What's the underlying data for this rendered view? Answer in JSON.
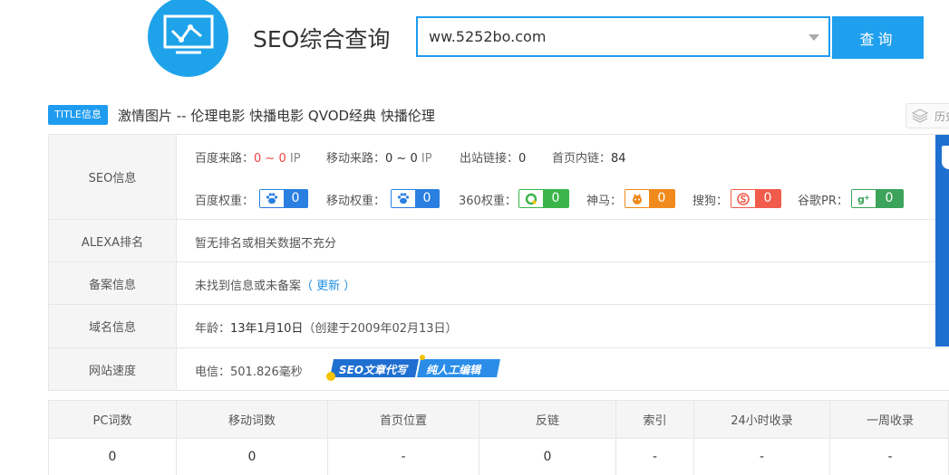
{
  "header": {
    "brand_title": "SEO综合查询",
    "search_value": "ww.5252bo.com",
    "search_button": "查询"
  },
  "title_row": {
    "tag": "TITLE信息",
    "text": "激情图片 -- 伦理电影 快播电影 QVOD经典 快播伦理",
    "history_label": "历史"
  },
  "seo": {
    "label": "SEO信息",
    "baidu_source_label": "百度来路：",
    "baidu_source_value": "0 ~ 0",
    "baidu_source_unit": "IP",
    "mobile_source_label": "移动来路：",
    "mobile_source_value": "0 ~ 0",
    "mobile_source_unit": "IP",
    "outlinks_label": "出站链接：",
    "outlinks_value": "0",
    "homepage_links_label": "首页内链：",
    "homepage_links_value": "84",
    "weights": [
      {
        "label": "百度权重：",
        "value": "0",
        "icon": "paw-icon",
        "color": "#2a7fe0"
      },
      {
        "label": "移动权重：",
        "value": "0",
        "icon": "paw-mobile-icon",
        "color": "#2a7fe0"
      },
      {
        "label": "360权重：",
        "value": "0",
        "icon": "circle-360-icon",
        "color": "#3bb54a"
      },
      {
        "label": "神马：",
        "value": "0",
        "icon": "horse-icon",
        "color": "#f08a1c"
      },
      {
        "label": "搜狗：",
        "value": "0",
        "icon": "sogou-icon",
        "color": "#f05b4b"
      },
      {
        "label": "谷歌PR：",
        "value": "0",
        "icon": "google-plus-icon",
        "color": "#3ba45a"
      }
    ]
  },
  "alexa": {
    "label": "ALEXA排名",
    "text": "暂无排名或相关数据不充分"
  },
  "beian": {
    "label": "备案信息",
    "text": "未找到信息或未备案",
    "update_link": "（ 更新 ）"
  },
  "domain": {
    "label": "域名信息",
    "age_label": "年龄：",
    "age_value": "13年1月10日",
    "created": "（创建于2009年02月13日）"
  },
  "speed": {
    "label": "网站速度",
    "text": "电信：501.826毫秒",
    "ad_left": "SEO文章代写",
    "ad_right": "纯人工编辑"
  },
  "bottom_table": {
    "headers": [
      "PC词数",
      "移动词数",
      "首页位置",
      "反链",
      "索引",
      "24小时收录",
      "一周收录"
    ],
    "values": [
      "0",
      "0",
      "-",
      "0",
      "-",
      "-",
      "-"
    ]
  },
  "colors": {
    "accent": "#1f9cf0",
    "logo": "#1ea3ea",
    "red": "#f24141",
    "strip": "#1f6fd1"
  }
}
